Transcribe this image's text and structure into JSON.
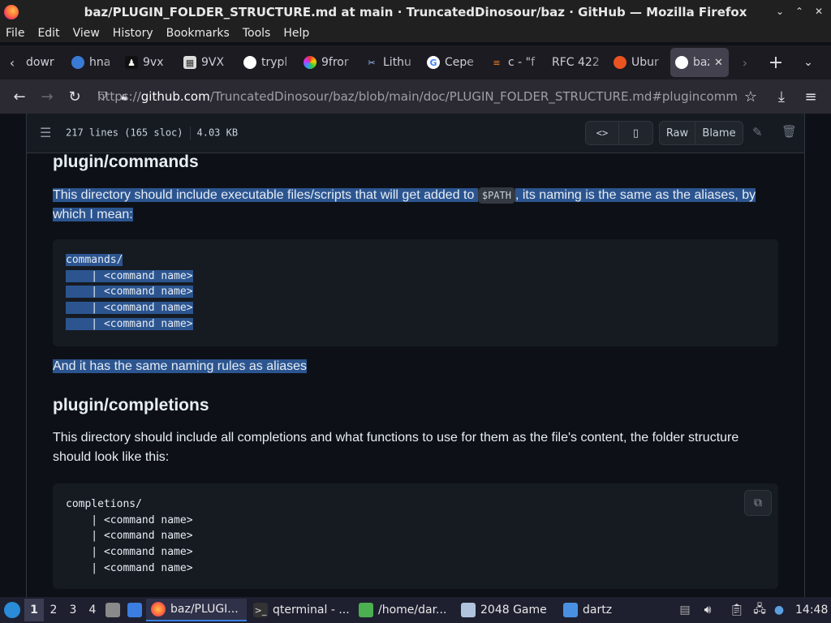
{
  "window": {
    "title": "baz/PLUGIN_FOLDER_STRUCTURE.md at main · TruncatedDinosour/baz · GitHub — Mozilla Firefox",
    "controls": [
      "⌄",
      "⌃",
      "✕"
    ]
  },
  "menu": [
    "File",
    "Edit",
    "View",
    "History",
    "Bookmarks",
    "Tools",
    "Help"
  ],
  "tabs": [
    {
      "label": "dowr",
      "icon": "download-icon"
    },
    {
      "label": "hna",
      "icon": "globe-icon"
    },
    {
      "label": "9vx",
      "icon": "site-icon"
    },
    {
      "label": "9VX",
      "icon": "site-icon"
    },
    {
      "label": "trypl",
      "icon": "github-icon"
    },
    {
      "label": "9fror",
      "icon": "rainbow-icon"
    },
    {
      "label": "Lithu",
      "icon": "tools-icon"
    },
    {
      "label": "Cepe",
      "icon": "google-icon"
    },
    {
      "label": "c - \"f",
      "icon": "stackoverflow-icon"
    },
    {
      "label": "RFC 422",
      "icon": ""
    },
    {
      "label": "Ubur",
      "icon": "ubuntu-icon"
    },
    {
      "label": "baz",
      "icon": "github-icon",
      "active": true
    }
  ],
  "url": {
    "prefix": "https://",
    "domain": "github.com",
    "path": "/TruncatedDinosour/baz/blob/main/doc/PLUGIN_FOLDER_STRUCTURE.md#plugincomm"
  },
  "file_header": {
    "lines": "217 lines (165 sloc)",
    "size": "4.03 KB",
    "raw": "Raw",
    "blame": "Blame"
  },
  "doc": {
    "h_commands": "plugin/commands",
    "p_commands_before": "This directory should include executable files/scripts that will get added to",
    "p_commands_code": "$PATH",
    "p_commands_after": ", its naming is the same as the aliases, by which I mean:",
    "code_commands": [
      "commands/",
      "    | <command name>",
      "    | <command name>",
      "    | <command name>",
      "    | <command name>"
    ],
    "p_naming": "And it has the same naming rules as aliases",
    "h_completions": "plugin/completions",
    "p_completions": "This directory should include all completions and what functions to use for them as the file's content, the folder structure should look like this:",
    "code_completions": [
      "completions/",
      "    | <command name>",
      "    | <command name>",
      "    | <command name>",
      "    | <command name>"
    ]
  },
  "taskbar": {
    "workspaces": [
      "1",
      "2",
      "3",
      "4"
    ],
    "apps": [
      {
        "label": "baz/PLUGI...",
        "icon": "firefox-icon",
        "active": true
      },
      {
        "label": "qterminal - ...",
        "icon": "terminal-icon"
      },
      {
        "label": "/home/dar...",
        "icon": "file-icon"
      },
      {
        "label": "2048 Game",
        "icon": "window-icon"
      },
      {
        "label": "dartz",
        "icon": "folder-icon"
      }
    ],
    "clock": "14:48"
  },
  "colors": {
    "selection": "#2c5590",
    "page_bg": "#0d1117",
    "firefox_chrome": "#2b2a33"
  }
}
